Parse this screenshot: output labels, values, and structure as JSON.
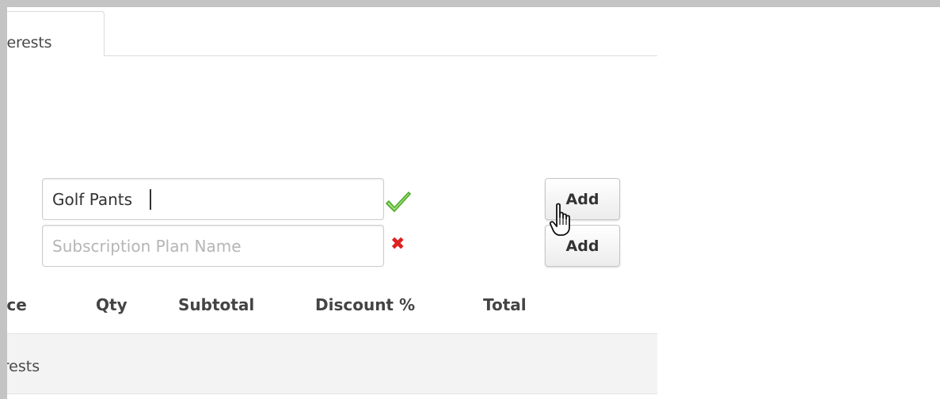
{
  "tab": {
    "label": "Interests"
  },
  "form": {
    "product_value": "Golf Pants",
    "plan_placeholder": "Subscription Plan Name",
    "add_label": "Add"
  },
  "table": {
    "columns": [
      "Price",
      "Qty",
      "Subtotal",
      "Discount %",
      "Total"
    ],
    "group_label": "Interests"
  },
  "icons": {
    "valid": "check-icon",
    "invalid": "x-icon",
    "cursor": "hand-pointer-icon"
  },
  "colors": {
    "valid": "#66cc33",
    "invalid": "#dd2222",
    "frame": "#c4c4c4",
    "row_background": "#f3f3f3"
  }
}
